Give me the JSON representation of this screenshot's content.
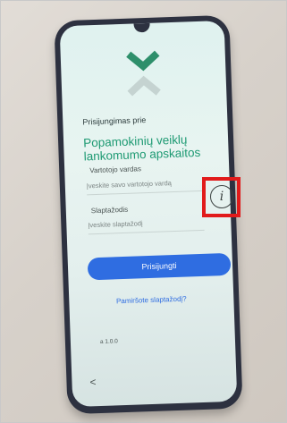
{
  "screen": {
    "heading": "Prisijungimas prie",
    "app_title": "Popamokinių veiklų lankomumo apskaitos",
    "username": {
      "label": "Vartotojo vardas",
      "placeholder": "Įveskite savo vartotojo vardą"
    },
    "password": {
      "label": "Slaptažodis",
      "placeholder": "Įveskite slaptažodį"
    },
    "info_symbol": "i",
    "login_label": "Prisijungti",
    "forgot_label": "Pamiršote slaptažodį?",
    "version": "a 1.0.0",
    "back_symbol": "<"
  },
  "colors": {
    "accent_green": "#1e9a73",
    "primary_blue": "#2f6de1",
    "highlight_red": "#e11b1b"
  },
  "icons": [
    "app-logo-icon",
    "info-icon",
    "back-icon"
  ]
}
